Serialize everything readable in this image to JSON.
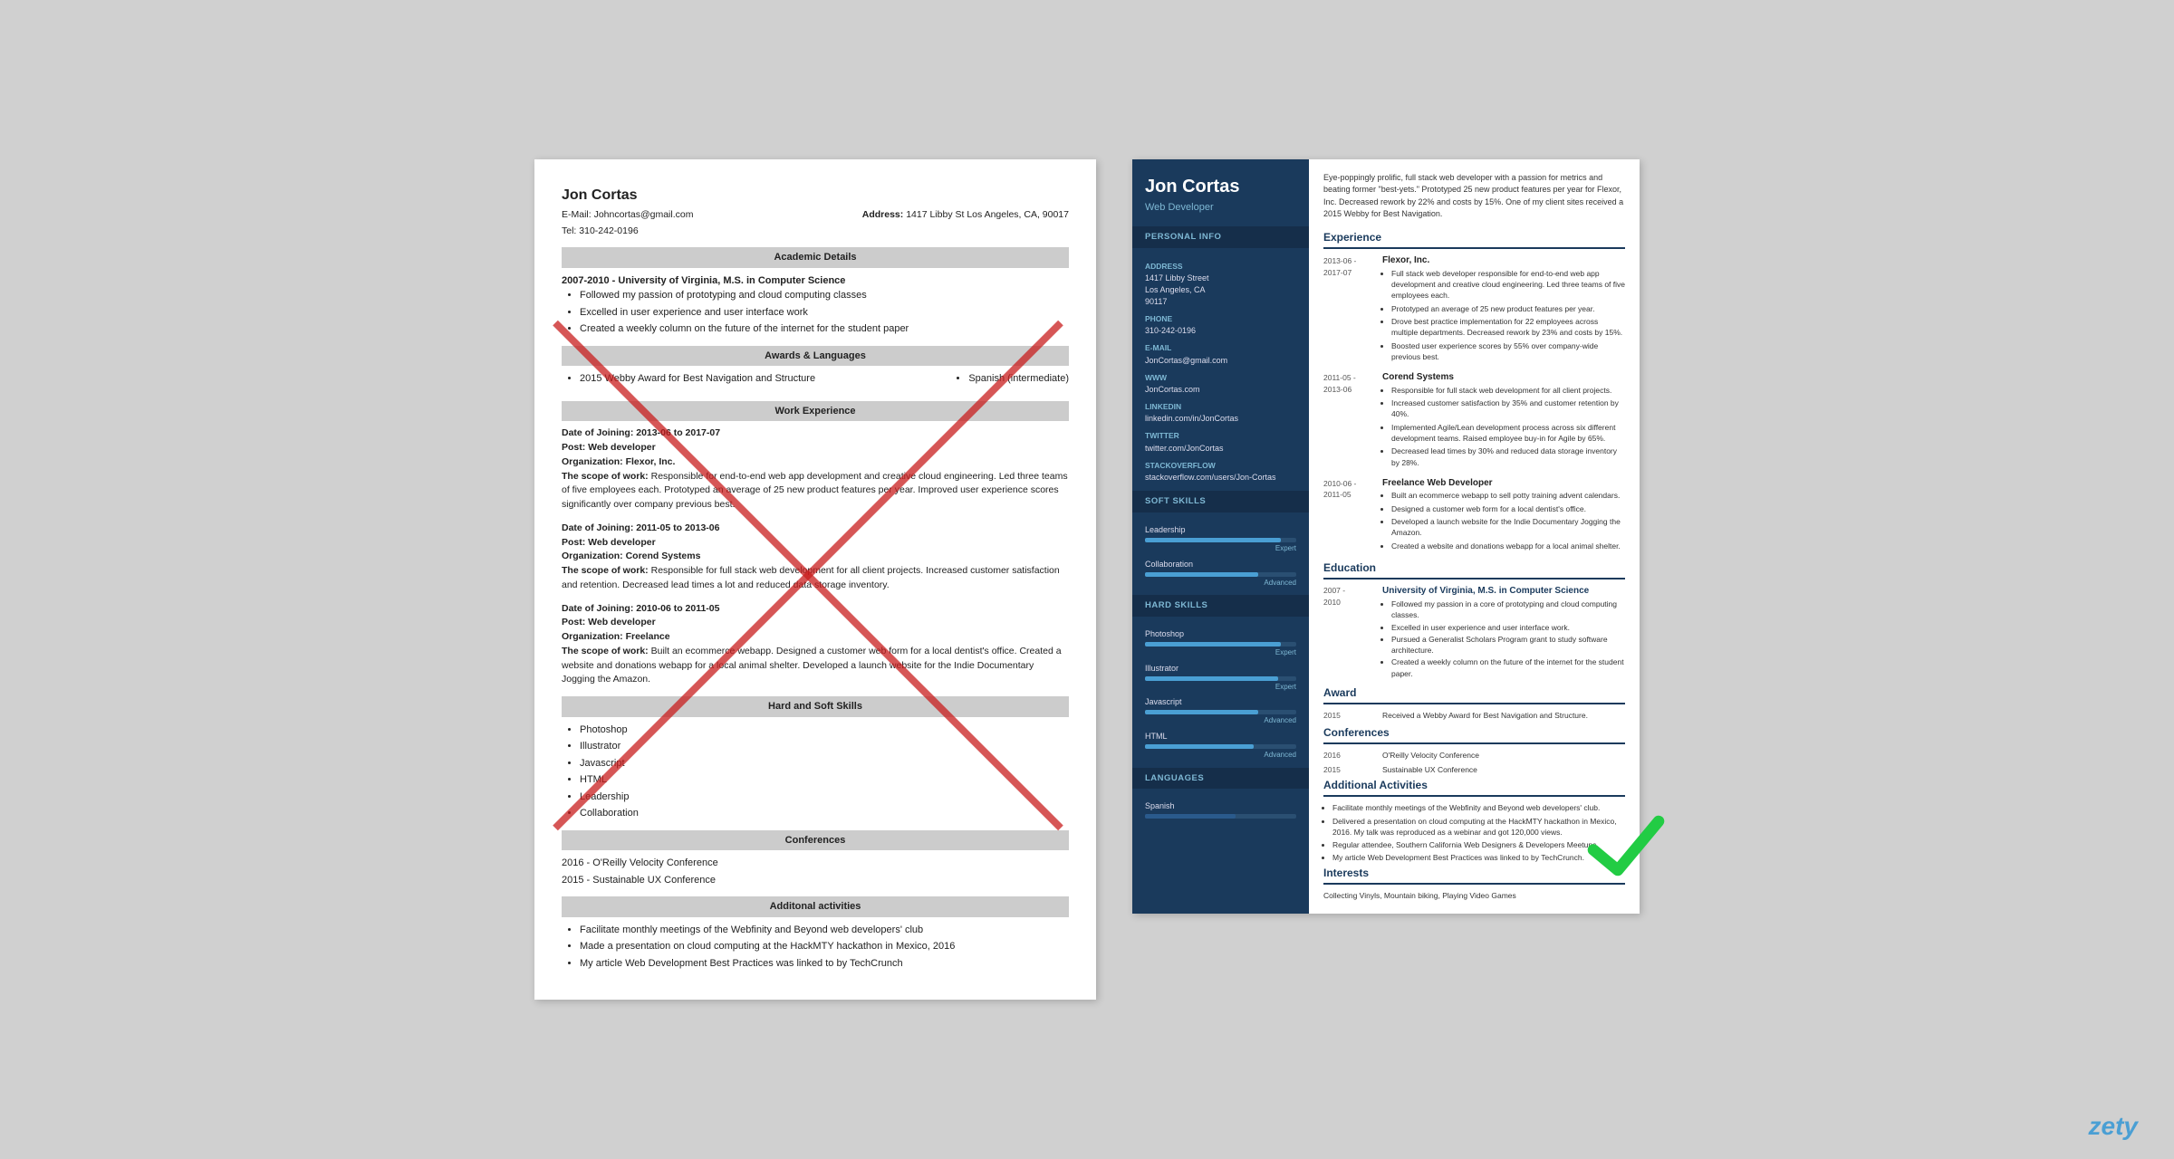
{
  "left_resume": {
    "name": "Jon Cortas",
    "email_label": "E-Mail:",
    "email": "Johncortas@gmail.com",
    "address_label": "Address:",
    "address": "1417 Libby St Los Angeles, CA, 90017",
    "tel_label": "Tel:",
    "tel": "310-242-0196",
    "sections": {
      "academic": {
        "title": "Academic Details",
        "entry": {
          "dates": "2007-2010 -",
          "degree": "University of Virginia, M.S. in Computer Science",
          "bullets": [
            "Followed my passion of prototyping and cloud computing classes",
            "Excelled in user experience and user interface work",
            "Created a weekly column on the future of the internet for the student paper"
          ]
        }
      },
      "awards": {
        "title": "Awards & Languages",
        "award": "2015 Webby Award for Best Navigation and Structure",
        "language": "Spanish (intermediate)"
      },
      "work": {
        "title": "Work Experience",
        "entries": [
          {
            "date_of_joining": "Date of Joining: 2013-06 to 2017-07",
            "post": "Post: Web developer",
            "org": "Organization: Flexor, Inc.",
            "scope_label": "The scope of work:",
            "scope": "Responsible for end-to-end web app development and creative cloud engineering. Led three teams of five employees each. Prototyped an average of 25 new product features per year. Improved user experience scores significantly over company previous best."
          },
          {
            "date_of_joining": "Date of Joining: 2011-05 to 2013-06",
            "post": "Post: Web developer",
            "org": "Organization: Corend Systems",
            "scope_label": "The scope of work:",
            "scope": "Responsible for full stack web development for all client projects. Increased customer satisfaction and retention. Decreased lead times a lot and reduced data storage inventory."
          },
          {
            "date_of_joining": "Date of Joining: 2010-06 to 2011-05",
            "post": "Post: Web developer",
            "org": "Organization: Freelance",
            "scope_label": "The scope of work:",
            "scope": "Built an ecommerce webapp. Designed a customer web form for a local dentist's office. Created a website and donations webapp for a local animal shelter. Developed a launch website for the Indie Documentary Jogging the Amazon."
          }
        ]
      },
      "skills": {
        "title": "Hard and Soft Skills",
        "items": [
          "Photoshop",
          "Illustrator",
          "Javascript",
          "HTML",
          "Leadership",
          "Collaboration"
        ]
      },
      "conferences": {
        "title": "Conferences",
        "items": [
          "2016 - O'Reilly Velocity Conference",
          "2015 - Sustainable UX Conference"
        ]
      },
      "activities": {
        "title": "Additonal activities",
        "items": [
          "Facilitate monthly meetings of the Webfinity and Beyond web developers' club",
          "Made a presentation on cloud computing at the HackMTY hackathon in Mexico, 2016",
          "My article Web Development Best Practices was linked to by TechCrunch"
        ]
      }
    }
  },
  "right_resume": {
    "name": "Jon Cortas",
    "title": "Web Developer",
    "summary": "Eye-poppingly prolific, full stack web developer with a passion for metrics and beating former \"best-yets.\" Prototyped 25 new product features per year for Flexor, Inc. Decreased rework by 22% and costs by 15%. One of my client sites received a 2015 Webby for Best Navigation.",
    "sidebar": {
      "personal_info_title": "Personal Info",
      "address_label": "Address",
      "address": "1417 Libby Street\nLos Angeles, CA\n90117",
      "phone_label": "Phone",
      "phone": "310-242-0196",
      "email_label": "E-mail",
      "email": "JonCortas@gmail.com",
      "www_label": "WWW",
      "www": "JonCortas.com",
      "linkedin_label": "LinkedIn",
      "linkedin": "linkedin.com/in/JonCortas",
      "twitter_label": "Twitter",
      "twitter": "twitter.com/JonCortas",
      "stackoverflow_label": "StackOverflow",
      "stackoverflow": "stackoverflow.com/users/Jon-Cortas",
      "soft_skills_title": "Soft Skills",
      "skills": [
        {
          "name": "Leadership",
          "level": "Expert",
          "percent": 90
        },
        {
          "name": "Collaboration",
          "level": "Advanced",
          "percent": 75
        }
      ],
      "hard_skills_title": "Hard Skills",
      "hard_skills": [
        {
          "name": "Photoshop",
          "level": "Expert",
          "percent": 90
        },
        {
          "name": "Illustrator",
          "level": "Expert",
          "percent": 88
        },
        {
          "name": "Javascript",
          "level": "Advanced",
          "percent": 75
        },
        {
          "name": "HTML",
          "level": "Advanced",
          "percent": 72
        }
      ],
      "languages_title": "Languages",
      "languages": [
        {
          "name": "Spanish",
          "percent": 60
        }
      ]
    },
    "main": {
      "experience_title": "Experience",
      "experiences": [
        {
          "dates": "2013-06 -\n2017-07",
          "company": "Flexor, Inc.",
          "bullets": [
            "Full stack web developer responsible for end-to-end web app development and creative cloud engineering. Led three teams of five employees each.",
            "Prototyped an average of 25 new product features per year.",
            "Drove best practice implementation for 22 employees across multiple departments. Decreased rework by 23% and costs by 15%.",
            "Boosted user experience scores by 55% over company-wide previous best."
          ]
        },
        {
          "dates": "2011-05 -\n2013-06",
          "company": "Corend Systems",
          "bullets": [
            "Responsible for full stack web development for all client projects.",
            "Increased customer satisfaction by 35% and customer retention by 40%.",
            "Implemented Agile/Lean development process across six different development teams. Raised employee buy-in for Agile by 65%.",
            "Decreased lead times by 30% and reduced data storage inventory by 28%."
          ]
        },
        {
          "dates": "2010-06 -\n2011-05",
          "company": "Freelance Web Developer",
          "bullets": [
            "Built an ecommerce webapp to sell potty training advent calendars.",
            "Designed a customer web form for a local dentist's office.",
            "Developed a launch website for the Indie Documentary Jogging the Amazon.",
            "Created a website and donations webapp for a local animal shelter."
          ]
        }
      ],
      "education_title": "Education",
      "education": [
        {
          "dates": "2007 -\n2010",
          "degree": "University of Virginia, M.S. in Computer Science",
          "bullets": [
            "Followed my passion in a core of prototyping and cloud computing classes.",
            "Excelled in user experience and user interface work.",
            "Pursued a Generalist Scholars Program grant to study software architecture.",
            "Created a weekly column on the future of the internet for the student paper."
          ]
        }
      ],
      "award_title": "Award",
      "award_year": "2015",
      "award_text": "Received a Webby Award for Best Navigation and Structure.",
      "conferences_title": "Conferences",
      "conferences": [
        {
          "year": "2016",
          "name": "O'Reilly Velocity Conference"
        },
        {
          "year": "2015",
          "name": "Sustainable UX Conference"
        }
      ],
      "activities_title": "Additional Activities",
      "activities": [
        "Facilitate monthly meetings of the Webfinity and Beyond web developers' club.",
        "Delivered a presentation on cloud computing at the HackMTY hackathon in Mexico, 2016. My talk was reproduced as a webinar and got 120,000 views.",
        "Regular attendee, Southern California Web Designers & Developers Meetups.",
        "My article Web Development Best Practices was linked to by TechCrunch."
      ],
      "interests_title": "Interests",
      "interests": "Collecting Vinyls, Mountain biking, Playing Video Games"
    }
  },
  "watermark": "zety"
}
